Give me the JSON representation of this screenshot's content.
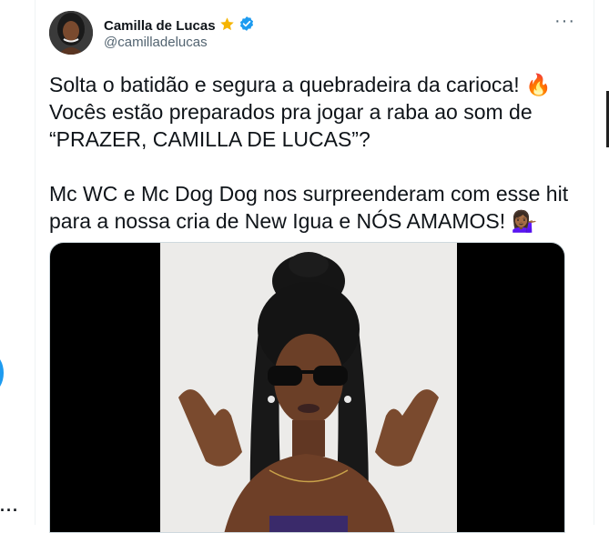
{
  "author": {
    "display_name": "Camilla de Lucas",
    "handle": "@camilladelucas"
  },
  "more_label": "···",
  "left_more_label": "···",
  "tweet": {
    "lines": [
      "Solta o batidão e segura a quebradeira da carioca! 🔥",
      "Vocês estão preparados pra jogar a raba ao som de",
      "“PRAZER, CAMILLA DE LUCAS”?",
      "Mc WC e Mc Dog Dog nos surpreenderam com esse hit",
      "para a nossa cria de New Igua e NÓS AMAMOS! 💁🏾‍♀️"
    ]
  },
  "colors": {
    "verified": "#1d9bf0",
    "star": "#f5b400",
    "text": "#0f1419",
    "secondary": "#536471"
  },
  "icons": {
    "star": "star-icon",
    "verified": "verified-badge-icon"
  }
}
